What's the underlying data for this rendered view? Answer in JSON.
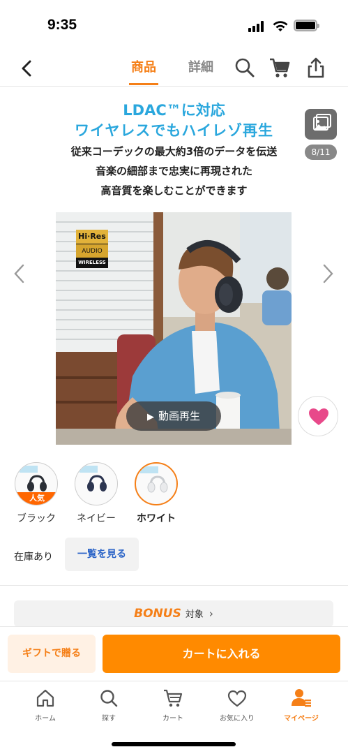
{
  "status_bar": {
    "time": "9:35"
  },
  "nav": {
    "tabs": [
      {
        "label": "商品",
        "active": true
      },
      {
        "label": "詳細",
        "active": false
      }
    ],
    "icons": [
      "back-chevron-icon",
      "search-icon",
      "cart-icon",
      "share-icon"
    ]
  },
  "gallery": {
    "headline_1": "LDAC™に対応",
    "headline_2": "ワイヤレスでもハイレゾ再生",
    "sub_1": "従来コーデックの最大約3倍のデータを伝送",
    "sub_2": "音楽の細部まで忠実に再現された",
    "sub_3": "高音質を楽しむことができます",
    "counter": "8/11",
    "hires_badge": {
      "top": "Hi·Res",
      "middle": "AUDIO",
      "bottom": "WIRELESS"
    },
    "video_button": "動画再生"
  },
  "variants": [
    {
      "label": "ブラック",
      "badge": "人気",
      "selected": false,
      "color": "#2b2f36"
    },
    {
      "label": "ネイビー",
      "badge": "",
      "selected": false,
      "color": "#2c3550"
    },
    {
      "label": "ホワイト",
      "badge": "",
      "selected": true,
      "color": "#e9eaec"
    }
  ],
  "stock": {
    "status": "在庫あり",
    "list_button": "一覧を見る"
  },
  "bonus": {
    "word": "BONUS",
    "target": "対象"
  },
  "actions": {
    "gift": "ギフトで贈る",
    "add_to_cart": "カートに入れる"
  },
  "tab_bar": [
    {
      "label": "ホーム",
      "icon": "home-icon",
      "active": false
    },
    {
      "label": "探す",
      "icon": "search-icon",
      "active": false
    },
    {
      "label": "カート",
      "icon": "cart-icon",
      "active": false
    },
    {
      "label": "お気に入り",
      "icon": "heart-icon",
      "active": false
    },
    {
      "label": "マイページ",
      "icon": "user-icon",
      "active": true
    }
  ],
  "colors": {
    "accent": "#f57f17",
    "cart_button": "#ff8a00",
    "headline": "#2aa7dd",
    "favorite": "#e8498a"
  }
}
